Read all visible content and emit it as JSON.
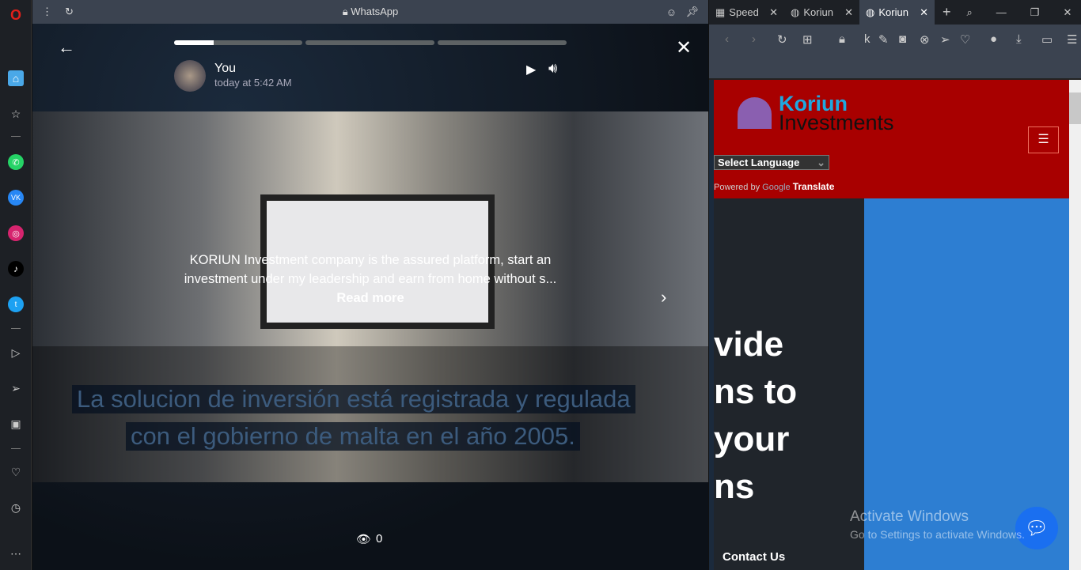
{
  "sidebar": {
    "items": [
      "opera-logo",
      "home",
      "bookmarks",
      "whatsapp",
      "vk",
      "instagram",
      "tiktok",
      "twitter",
      "player",
      "send",
      "wallet",
      "heart",
      "history",
      "more"
    ]
  },
  "whatsapp": {
    "title": "WhatsApp",
    "status": {
      "author": "You",
      "time": "today at 5:42 AM",
      "progress_first_segment": 0.31,
      "segments": 3,
      "caption": "KORIUN Investment company is the assured platform, start an investment under my leadership and earn from home without s...",
      "read_more": "Read more",
      "subtitle_line1": "La solucion de inversión está registrada y regulada",
      "subtitle_line2": "con el gobierno de malta en el año 2005.",
      "views": "0"
    }
  },
  "browser": {
    "tabs": [
      {
        "label": "Speed"
      },
      {
        "label": "Koriun"
      },
      {
        "label": "Koriun",
        "active": true
      }
    ],
    "site": {
      "brand_top": "Koriun",
      "brand_bottom": "Investments",
      "select_language": "Select Language",
      "powered_by": "Powered by",
      "google": "Google",
      "translate": "Translate",
      "hero_lines": [
        "vide",
        "ns to",
        "your",
        "ns"
      ],
      "contact": "Contact Us",
      "header_color": "#a80000"
    }
  },
  "watermark": {
    "line1": "Activate Windows",
    "line2": "Go to Settings to activate Windows."
  }
}
